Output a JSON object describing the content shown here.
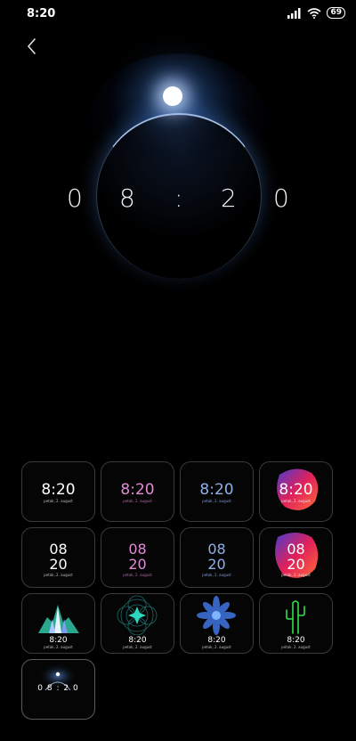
{
  "status": {
    "time": "8:20",
    "battery": "69"
  },
  "preview": {
    "digits": [
      "0",
      "8",
      ":",
      "2",
      "0"
    ]
  },
  "tiles": [
    {
      "time": "8:20",
      "date": "petak, 2. august",
      "time_color": "#ffffff",
      "date_color": "#bdbdbd"
    },
    {
      "time": "8:20",
      "date": "petak, 2. august",
      "time_color": "#e48ad8",
      "date_color": "#b06aa8"
    },
    {
      "time": "8:20",
      "date": "petak, 2. august",
      "time_color": "#8fb0e8",
      "date_color": "#7f9fd6"
    },
    {
      "time": "8:20",
      "date": "petak, 2. august",
      "time_color": "#ffffff",
      "date_color": "#e0e0e0"
    },
    {
      "hour": "08",
      "minute": "20",
      "date": "petak, 2. august",
      "color": "#ffffff"
    },
    {
      "hour": "08",
      "minute": "20",
      "date": "petak, 2. august",
      "color": "#e48ad8"
    },
    {
      "hour": "08",
      "minute": "20",
      "date": "petak, 2. august",
      "color": "#8fb0e8"
    },
    {
      "hour": "08",
      "minute": "20",
      "date": "petak, 2. august",
      "color": "#ffffff"
    },
    {
      "time": "8:20",
      "date": "petak, 2. august"
    },
    {
      "time": "8:20",
      "date": "petak, 2. august"
    },
    {
      "time": "8:20",
      "date": "petak, 2. august"
    },
    {
      "time": "8:20",
      "date": "petak, 2. august"
    },
    {
      "time": "0 8 : 2 0"
    }
  ],
  "colors": {
    "accent_blue": "#3d6fd6",
    "cactus_green": "#2ee04a",
    "blob_pink": "#e0205a",
    "blob_blue": "#4a3ccf"
  },
  "icons": {
    "back": "back-chevron-icon",
    "signal": "signal-icon",
    "wifi": "wifi-icon"
  }
}
